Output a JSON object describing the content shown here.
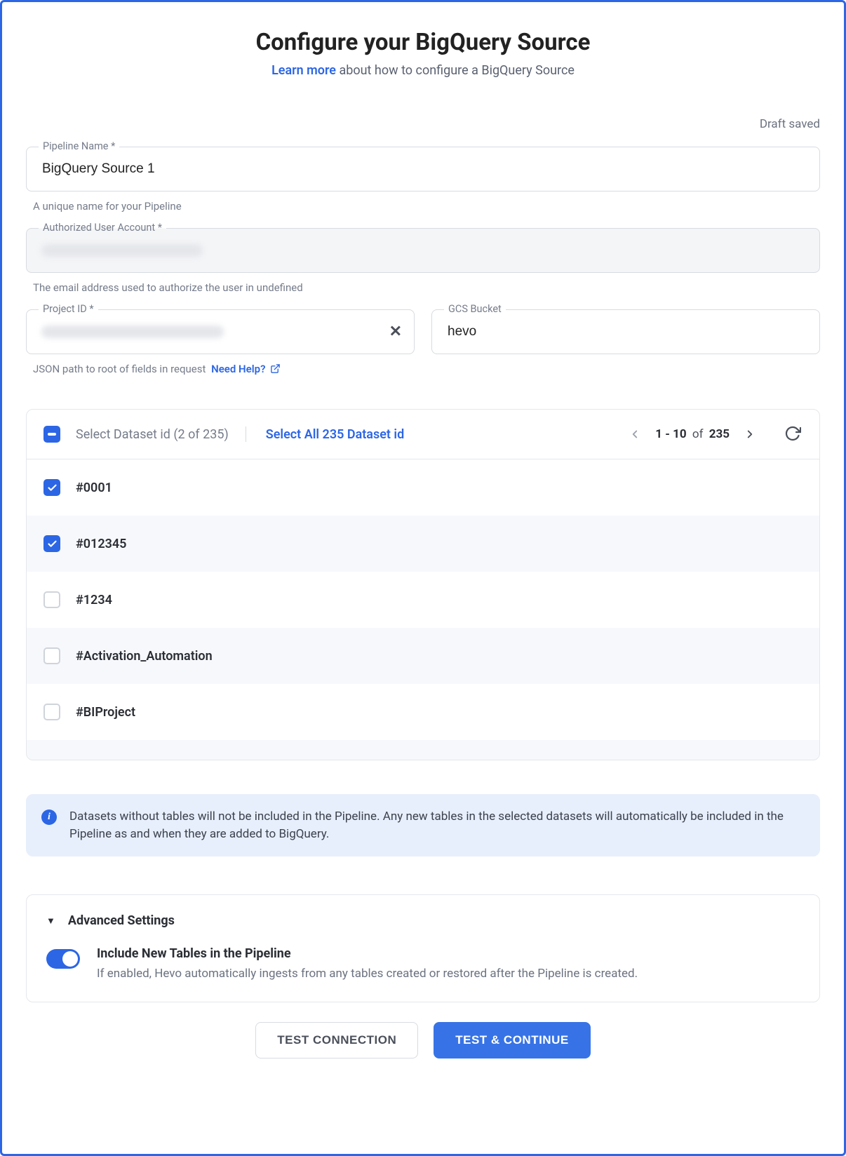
{
  "header": {
    "title": "Configure your BigQuery Source",
    "learn_more": "Learn more",
    "subtitle_rest": " about how to configure a BigQuery Source",
    "draft_saved": "Draft saved"
  },
  "pipeline_name": {
    "label": "Pipeline Name *",
    "value": "BigQuery Source 1",
    "helper": "A unique name for your Pipeline"
  },
  "authorized_user": {
    "label": "Authorized User Account *",
    "value": "",
    "helper": "The email address used to authorize the user in undefined"
  },
  "project_id": {
    "label": "Project ID *",
    "value": "",
    "helper": "JSON path to root of fields in request",
    "need_help": "Need Help?"
  },
  "gcs_bucket": {
    "label": "GCS Bucket",
    "value": "hevo"
  },
  "datasets": {
    "title_prefix": "Select Dataset id",
    "selected_count": 2,
    "total_count": 235,
    "title": "Select Dataset id (2 of 235)",
    "select_all": "Select All 235 Dataset id",
    "pager_from": 1,
    "pager_to": 10,
    "pager_label": "1 - 10",
    "pager_total": "235",
    "pager_of": "of",
    "items": [
      {
        "label": "#0001",
        "checked": true
      },
      {
        "label": "#012345",
        "checked": true
      },
      {
        "label": "#1234",
        "checked": false
      },
      {
        "label": "#Activation_Automation",
        "checked": false
      },
      {
        "label": "#BIProject",
        "checked": false
      }
    ]
  },
  "info_banner": "Datasets without tables will not be included in the Pipeline. Any new tables in the selected datasets will automatically be included in the Pipeline as and when they are added to BigQuery.",
  "advanced": {
    "header": "Advanced Settings",
    "include_new_tables": {
      "title": "Include New Tables in the Pipeline",
      "desc": "If enabled, Hevo automatically ingests from any tables created or restored after the Pipeline is created.",
      "enabled": true
    }
  },
  "footer": {
    "test_connection": "TEST CONNECTION",
    "test_continue": "TEST & CONTINUE"
  }
}
